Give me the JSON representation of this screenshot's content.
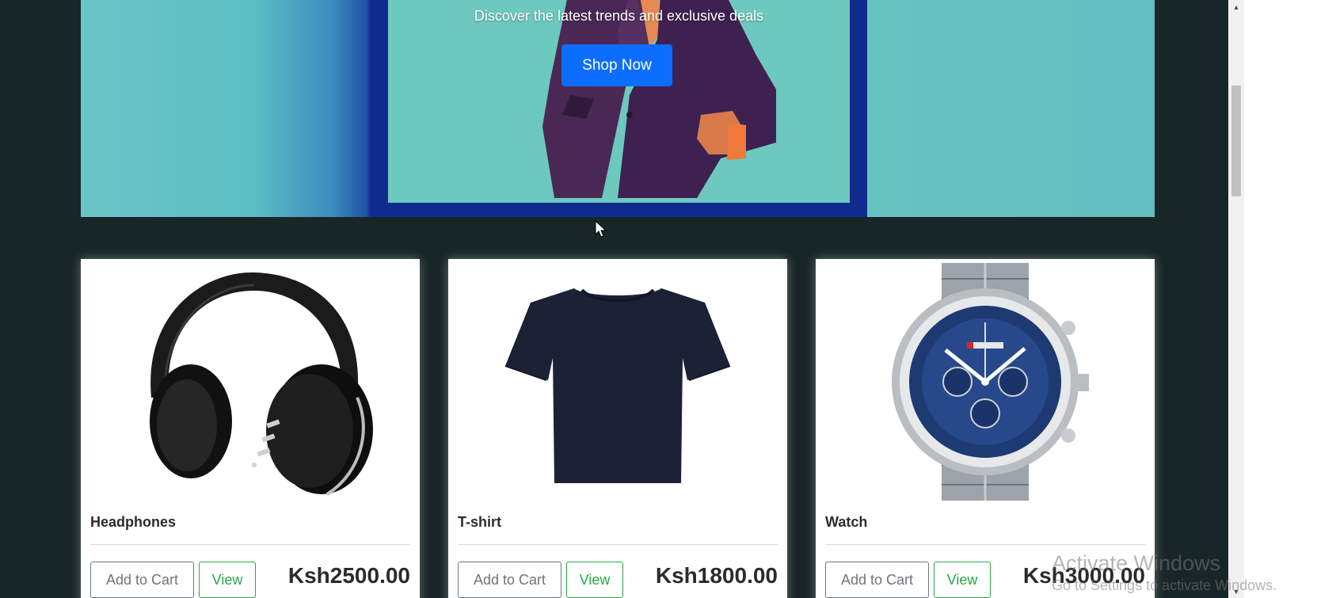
{
  "hero": {
    "tagline": "Discover the latest trends and exclusive deals",
    "cta_label": "Shop Now"
  },
  "products": [
    {
      "name": "Headphones",
      "add_to_cart": "Add to Cart",
      "view": "View",
      "price": "Ksh2500.00",
      "image": "headphones-image"
    },
    {
      "name": "T-shirt",
      "add_to_cart": "Add to Cart",
      "view": "View",
      "price": "Ksh1800.00",
      "image": "tshirt-image"
    },
    {
      "name": "Watch",
      "add_to_cart": "Add to Cart",
      "view": "View",
      "price": "Ksh3000.00",
      "image": "watch-image"
    }
  ],
  "watermark": {
    "title": "Activate Windows",
    "subtitle": "Go to Settings to activate Windows."
  },
  "colors": {
    "page_bg": "#182628",
    "primary_button": "#0d6efd",
    "view_button": "#28a745",
    "cart_button": "#6c757d",
    "hero_teal": "#6dc8bd",
    "hero_frame": "#0f2b8e"
  }
}
